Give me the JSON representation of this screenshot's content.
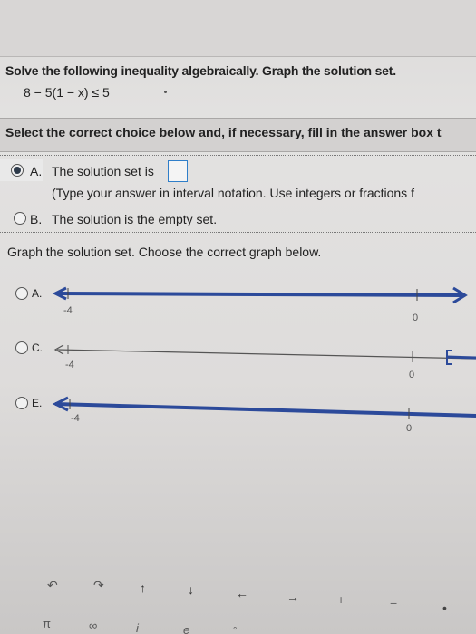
{
  "question": {
    "title": "Solve the following inequality algebraically. Graph the solution set.",
    "inequality": "8 − 5(1 − x) ≤ 5"
  },
  "instruction": "Select the correct choice below and, if necessary, fill in the answer box t",
  "choices": [
    {
      "letter": "A.",
      "text": "The solution set is",
      "hint": "(Type your answer in interval notation. Use integers or fractions f",
      "selected": true
    },
    {
      "letter": "B.",
      "text": "The solution is the empty set.",
      "selected": false
    }
  ],
  "graph_prompt": "Graph the solution set. Choose the correct graph below.",
  "graph_options": [
    {
      "label": "A.",
      "left_tick": "-4",
      "right_tick": "0"
    },
    {
      "label": "C.",
      "left_tick": "-4",
      "right_tick": "0"
    },
    {
      "label": "E.",
      "left_tick": "-4",
      "right_tick": "0"
    }
  ],
  "keypad": [
    "↶",
    "↷",
    "↑",
    "↓",
    "←",
    "→",
    "+",
    "−",
    "•",
    "π",
    "∞",
    "i",
    "e",
    "°"
  ],
  "colors": {
    "accent": "#2f7ec9",
    "line": "#2c4a9a",
    "radio_selected": "#2d3a4a"
  }
}
